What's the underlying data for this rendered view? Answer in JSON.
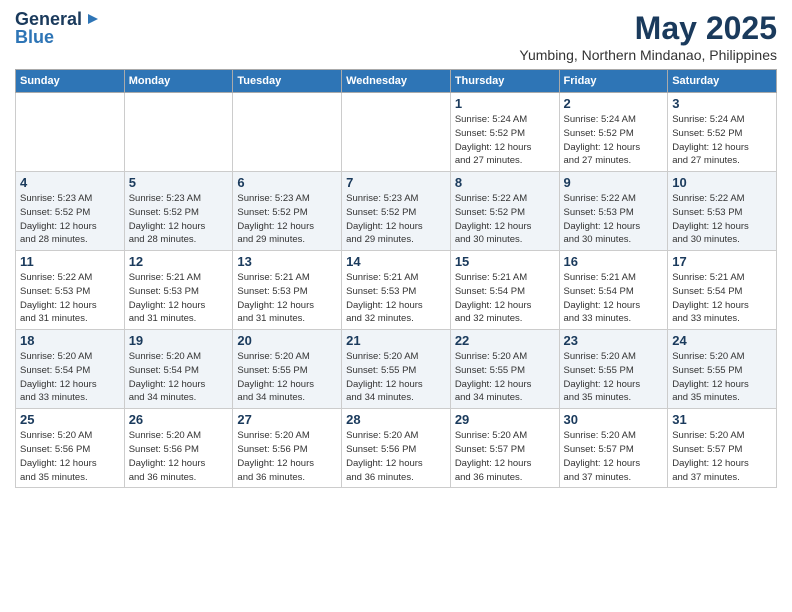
{
  "header": {
    "logo_line1": "General",
    "logo_line2": "Blue",
    "main_title": "May 2025",
    "subtitle": "Yumbing, Northern Mindanao, Philippines"
  },
  "weekdays": [
    "Sunday",
    "Monday",
    "Tuesday",
    "Wednesday",
    "Thursday",
    "Friday",
    "Saturday"
  ],
  "weeks": [
    [
      {
        "day": "",
        "info": ""
      },
      {
        "day": "",
        "info": ""
      },
      {
        "day": "",
        "info": ""
      },
      {
        "day": "",
        "info": ""
      },
      {
        "day": "1",
        "info": "Sunrise: 5:24 AM\nSunset: 5:52 PM\nDaylight: 12 hours\nand 27 minutes."
      },
      {
        "day": "2",
        "info": "Sunrise: 5:24 AM\nSunset: 5:52 PM\nDaylight: 12 hours\nand 27 minutes."
      },
      {
        "day": "3",
        "info": "Sunrise: 5:24 AM\nSunset: 5:52 PM\nDaylight: 12 hours\nand 27 minutes."
      }
    ],
    [
      {
        "day": "4",
        "info": "Sunrise: 5:23 AM\nSunset: 5:52 PM\nDaylight: 12 hours\nand 28 minutes."
      },
      {
        "day": "5",
        "info": "Sunrise: 5:23 AM\nSunset: 5:52 PM\nDaylight: 12 hours\nand 28 minutes."
      },
      {
        "day": "6",
        "info": "Sunrise: 5:23 AM\nSunset: 5:52 PM\nDaylight: 12 hours\nand 29 minutes."
      },
      {
        "day": "7",
        "info": "Sunrise: 5:23 AM\nSunset: 5:52 PM\nDaylight: 12 hours\nand 29 minutes."
      },
      {
        "day": "8",
        "info": "Sunrise: 5:22 AM\nSunset: 5:52 PM\nDaylight: 12 hours\nand 30 minutes."
      },
      {
        "day": "9",
        "info": "Sunrise: 5:22 AM\nSunset: 5:53 PM\nDaylight: 12 hours\nand 30 minutes."
      },
      {
        "day": "10",
        "info": "Sunrise: 5:22 AM\nSunset: 5:53 PM\nDaylight: 12 hours\nand 30 minutes."
      }
    ],
    [
      {
        "day": "11",
        "info": "Sunrise: 5:22 AM\nSunset: 5:53 PM\nDaylight: 12 hours\nand 31 minutes."
      },
      {
        "day": "12",
        "info": "Sunrise: 5:21 AM\nSunset: 5:53 PM\nDaylight: 12 hours\nand 31 minutes."
      },
      {
        "day": "13",
        "info": "Sunrise: 5:21 AM\nSunset: 5:53 PM\nDaylight: 12 hours\nand 31 minutes."
      },
      {
        "day": "14",
        "info": "Sunrise: 5:21 AM\nSunset: 5:53 PM\nDaylight: 12 hours\nand 32 minutes."
      },
      {
        "day": "15",
        "info": "Sunrise: 5:21 AM\nSunset: 5:54 PM\nDaylight: 12 hours\nand 32 minutes."
      },
      {
        "day": "16",
        "info": "Sunrise: 5:21 AM\nSunset: 5:54 PM\nDaylight: 12 hours\nand 33 minutes."
      },
      {
        "day": "17",
        "info": "Sunrise: 5:21 AM\nSunset: 5:54 PM\nDaylight: 12 hours\nand 33 minutes."
      }
    ],
    [
      {
        "day": "18",
        "info": "Sunrise: 5:20 AM\nSunset: 5:54 PM\nDaylight: 12 hours\nand 33 minutes."
      },
      {
        "day": "19",
        "info": "Sunrise: 5:20 AM\nSunset: 5:54 PM\nDaylight: 12 hours\nand 34 minutes."
      },
      {
        "day": "20",
        "info": "Sunrise: 5:20 AM\nSunset: 5:55 PM\nDaylight: 12 hours\nand 34 minutes."
      },
      {
        "day": "21",
        "info": "Sunrise: 5:20 AM\nSunset: 5:55 PM\nDaylight: 12 hours\nand 34 minutes."
      },
      {
        "day": "22",
        "info": "Sunrise: 5:20 AM\nSunset: 5:55 PM\nDaylight: 12 hours\nand 34 minutes."
      },
      {
        "day": "23",
        "info": "Sunrise: 5:20 AM\nSunset: 5:55 PM\nDaylight: 12 hours\nand 35 minutes."
      },
      {
        "day": "24",
        "info": "Sunrise: 5:20 AM\nSunset: 5:55 PM\nDaylight: 12 hours\nand 35 minutes."
      }
    ],
    [
      {
        "day": "25",
        "info": "Sunrise: 5:20 AM\nSunset: 5:56 PM\nDaylight: 12 hours\nand 35 minutes."
      },
      {
        "day": "26",
        "info": "Sunrise: 5:20 AM\nSunset: 5:56 PM\nDaylight: 12 hours\nand 36 minutes."
      },
      {
        "day": "27",
        "info": "Sunrise: 5:20 AM\nSunset: 5:56 PM\nDaylight: 12 hours\nand 36 minutes."
      },
      {
        "day": "28",
        "info": "Sunrise: 5:20 AM\nSunset: 5:56 PM\nDaylight: 12 hours\nand 36 minutes."
      },
      {
        "day": "29",
        "info": "Sunrise: 5:20 AM\nSunset: 5:57 PM\nDaylight: 12 hours\nand 36 minutes."
      },
      {
        "day": "30",
        "info": "Sunrise: 5:20 AM\nSunset: 5:57 PM\nDaylight: 12 hours\nand 37 minutes."
      },
      {
        "day": "31",
        "info": "Sunrise: 5:20 AM\nSunset: 5:57 PM\nDaylight: 12 hours\nand 37 minutes."
      }
    ]
  ]
}
